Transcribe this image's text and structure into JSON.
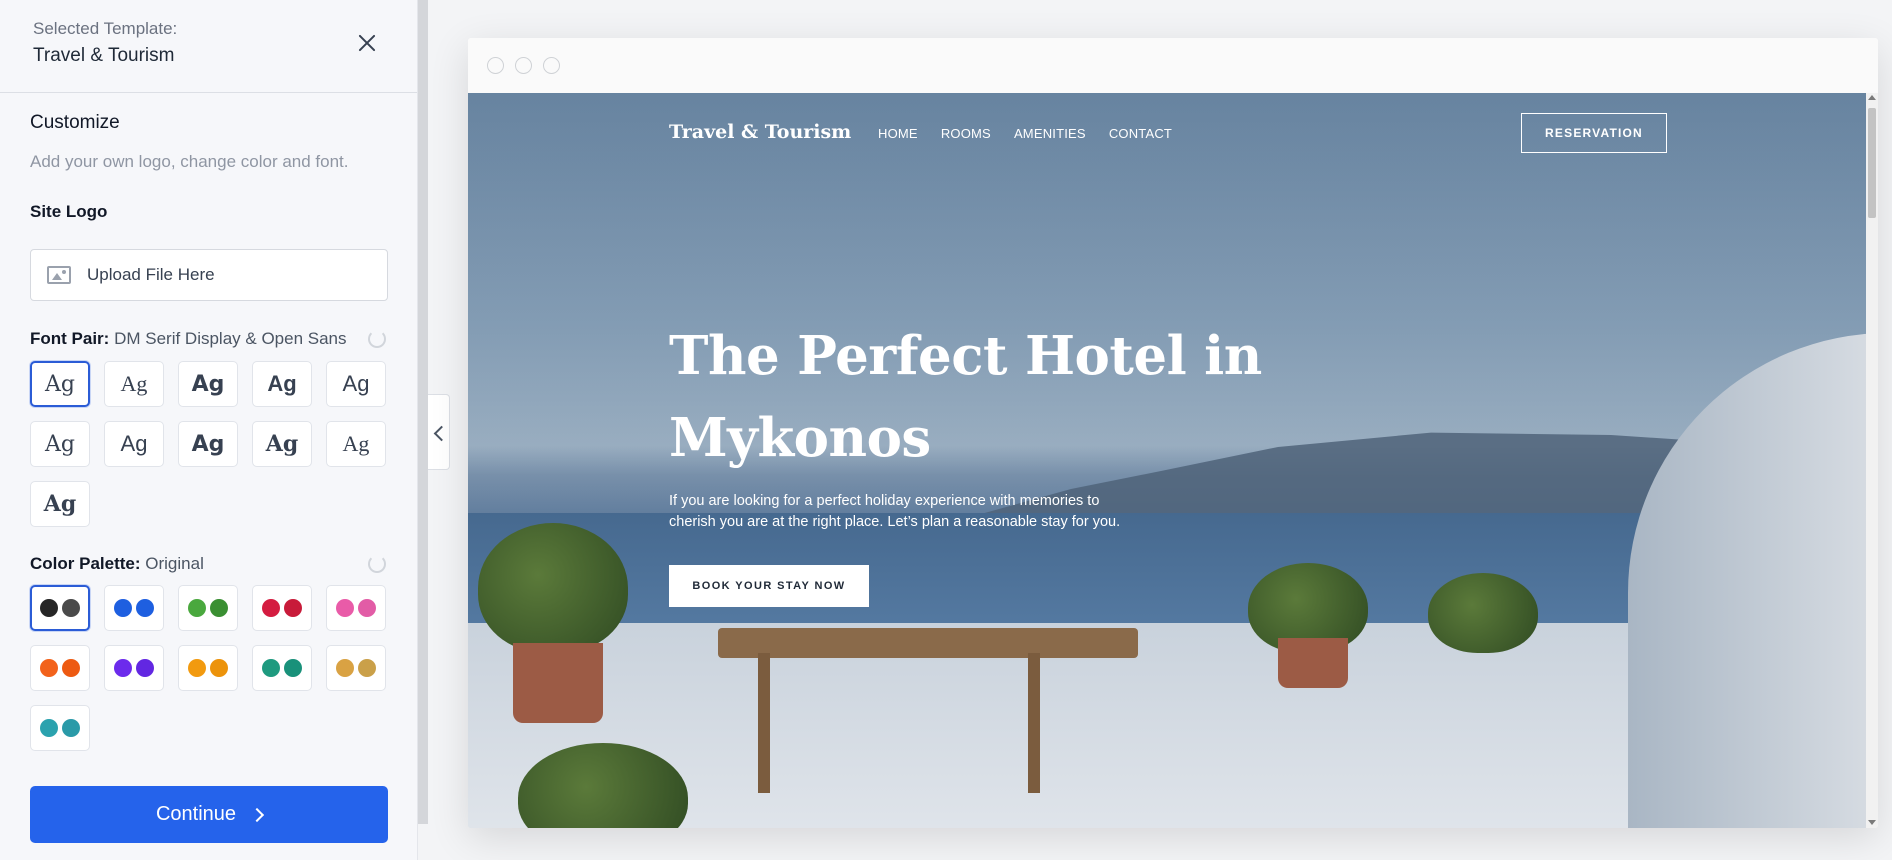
{
  "sidebar": {
    "header": {
      "label": "Selected Template:",
      "title": "Travel & Tourism"
    },
    "customize": {
      "title": "Customize",
      "subtitle": "Add your own logo, change color and font."
    },
    "logo": {
      "title": "Site Logo",
      "upload_label": "Upload File Here"
    },
    "font_pair": {
      "label": "Font Pair:",
      "value": "DM Serif Display & Open Sans",
      "tiles": [
        "Ag",
        "Ag",
        "Ag",
        "Ag",
        "Ag",
        "Ag",
        "Ag",
        "Ag",
        "Ag",
        "Ag",
        "Ag"
      ],
      "selected_index": 0
    },
    "color_palette": {
      "label": "Color Palette:",
      "value": "Original",
      "palettes": [
        [
          "#262626",
          "#4a4a4a"
        ],
        [
          "#1e5fe0",
          "#1e5fe0"
        ],
        [
          "#4aa83e",
          "#3a8f32"
        ],
        [
          "#d41c40",
          "#c81b3a"
        ],
        [
          "#e95ba8",
          "#e25ca6"
        ],
        [
          "#f2621b",
          "#ed5a12"
        ],
        [
          "#6c2bec",
          "#6227e2"
        ],
        [
          "#f29a0f",
          "#ec930b"
        ],
        [
          "#1e9a7f",
          "#19917a"
        ],
        [
          "#d9a243",
          "#caa049"
        ],
        [
          "#2ba2ae",
          "#2a9aa8"
        ]
      ],
      "selected_index": 0
    },
    "continue_label": "Continue"
  },
  "preview": {
    "brand": "Travel & Tourism",
    "menu": [
      "HOME",
      "ROOMS",
      "AMENITIES",
      "CONTACT"
    ],
    "reservation_label": "RESERVATION",
    "hero_title": "The Perfect Hotel in Mykonos",
    "hero_subtitle": "If you are looking for a perfect holiday experience with memories to cherish you are at the right place. Let’s plan a reasonable stay for you.",
    "cta_label": "BOOK YOUR STAY NOW"
  }
}
